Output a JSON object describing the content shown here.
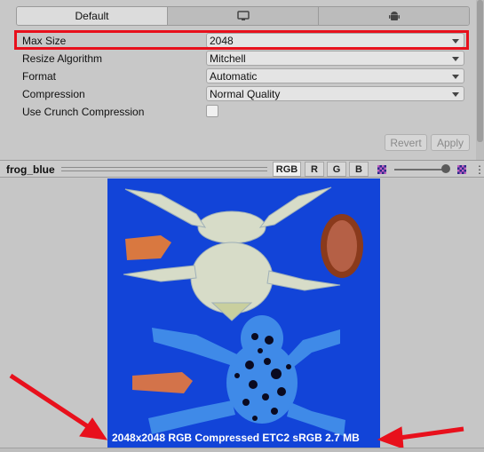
{
  "tabs": [
    {
      "label": "Default",
      "icon": "",
      "active": true
    },
    {
      "label": "",
      "icon": "monitor-icon",
      "active": false
    },
    {
      "label": "",
      "icon": "android-icon",
      "active": false
    }
  ],
  "settings": {
    "max_size": {
      "label": "Max Size",
      "value": "2048"
    },
    "resize_algorithm": {
      "label": "Resize Algorithm",
      "value": "Mitchell"
    },
    "format": {
      "label": "Format",
      "value": "Automatic"
    },
    "compression": {
      "label": "Compression",
      "value": "Normal Quality"
    },
    "crunch": {
      "label": "Use Crunch Compression",
      "checked": false
    }
  },
  "buttons": {
    "revert": "Revert",
    "apply": "Apply"
  },
  "preview": {
    "title": "frog_blue",
    "channels": [
      "RGB",
      "R",
      "G",
      "B"
    ],
    "active_channel": "RGB",
    "info": "2048x2048  RGB Compressed ETC2 sRGB   2.7 MB"
  },
  "colors": {
    "highlight": "#e8101c",
    "arrow": "#e8101c",
    "texture_background": "#1244d8"
  }
}
